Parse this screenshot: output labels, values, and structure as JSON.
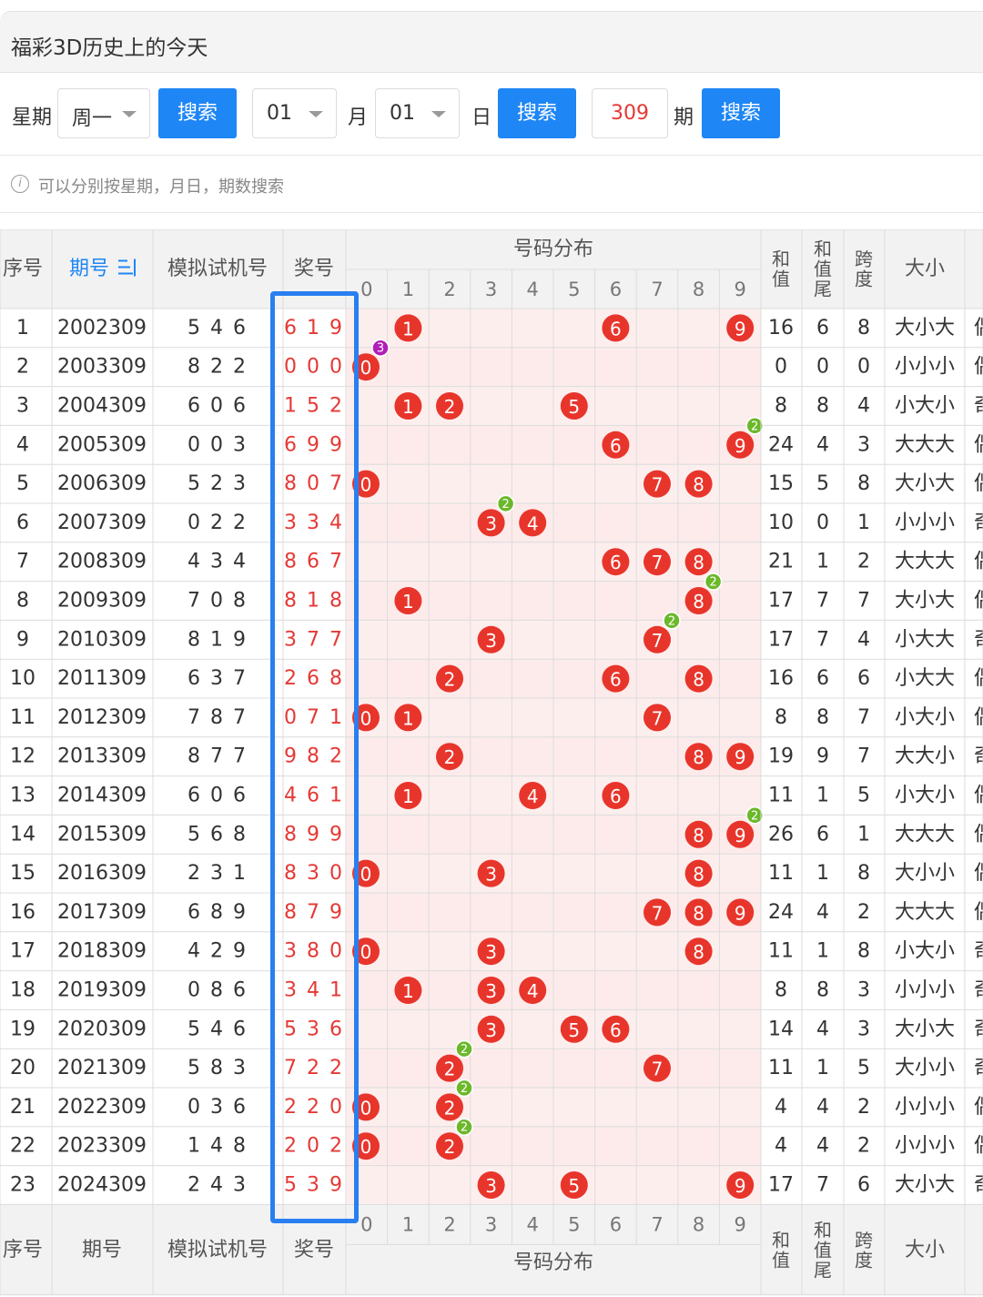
{
  "page_title": "福彩3D历史上的今天",
  "search": {
    "weekday_label": "星期",
    "weekday_value": "周一",
    "search_label": "搜索",
    "month_value": "01",
    "month_label": "月",
    "day_value": "01",
    "day_label": "日",
    "issue_value": "309",
    "issue_label": "期"
  },
  "hint": "可以分别按星期，月日，期数搜索",
  "table": {
    "headers": {
      "index": "序号",
      "issue": "期号",
      "sim": "模拟试机号",
      "prize": "奖号",
      "dist": "号码分布",
      "sum": "和值",
      "sum_tail": "和值尾",
      "span": "跨度",
      "size": "大小"
    },
    "digits": [
      "0",
      "1",
      "2",
      "3",
      "4",
      "5",
      "6",
      "7",
      "8",
      "9"
    ],
    "rows": [
      {
        "idx": "1",
        "issue": "2002309",
        "sim": "5 4 6",
        "prize": "6 1 9",
        "sum": "16",
        "tail": "6",
        "span": "8",
        "size": "大小大",
        "ex": "偶"
      },
      {
        "idx": "2",
        "issue": "2003309",
        "sim": "8 2 2",
        "prize": "0 0 0",
        "sum": "0",
        "tail": "0",
        "span": "0",
        "size": "小小小",
        "ex": "偶"
      },
      {
        "idx": "3",
        "issue": "2004309",
        "sim": "6 0 6",
        "prize": "1 5 2",
        "sum": "8",
        "tail": "8",
        "span": "4",
        "size": "小大小",
        "ex": "奇"
      },
      {
        "idx": "4",
        "issue": "2005309",
        "sim": "0 0 3",
        "prize": "6 9 9",
        "sum": "24",
        "tail": "4",
        "span": "3",
        "size": "大大大",
        "ex": "偶"
      },
      {
        "idx": "5",
        "issue": "2006309",
        "sim": "5 2 3",
        "prize": "8 0 7",
        "sum": "15",
        "tail": "5",
        "span": "8",
        "size": "大小大",
        "ex": "偶"
      },
      {
        "idx": "6",
        "issue": "2007309",
        "sim": "0 2 2",
        "prize": "3 3 4",
        "sum": "10",
        "tail": "0",
        "span": "1",
        "size": "小小小",
        "ex": "奇"
      },
      {
        "idx": "7",
        "issue": "2008309",
        "sim": "4 3 4",
        "prize": "8 6 7",
        "sum": "21",
        "tail": "1",
        "span": "2",
        "size": "大大大",
        "ex": "偶"
      },
      {
        "idx": "8",
        "issue": "2009309",
        "sim": "7 0 8",
        "prize": "8 1 8",
        "sum": "17",
        "tail": "7",
        "span": "7",
        "size": "大小大",
        "ex": "偶"
      },
      {
        "idx": "9",
        "issue": "2010309",
        "sim": "8 1 9",
        "prize": "3 7 7",
        "sum": "17",
        "tail": "7",
        "span": "4",
        "size": "小大大",
        "ex": "奇"
      },
      {
        "idx": "10",
        "issue": "2011309",
        "sim": "6 3 7",
        "prize": "2 6 8",
        "sum": "16",
        "tail": "6",
        "span": "6",
        "size": "小大大",
        "ex": "偶"
      },
      {
        "idx": "11",
        "issue": "2012309",
        "sim": "7 8 7",
        "prize": "0 7 1",
        "sum": "8",
        "tail": "8",
        "span": "7",
        "size": "小大小",
        "ex": "偶"
      },
      {
        "idx": "12",
        "issue": "2013309",
        "sim": "8 7 7",
        "prize": "9 8 2",
        "sum": "19",
        "tail": "9",
        "span": "7",
        "size": "大大小",
        "ex": "奇"
      },
      {
        "idx": "13",
        "issue": "2014309",
        "sim": "6 0 6",
        "prize": "4 6 1",
        "sum": "11",
        "tail": "1",
        "span": "5",
        "size": "小大小",
        "ex": "偶"
      },
      {
        "idx": "14",
        "issue": "2015309",
        "sim": "5 6 8",
        "prize": "8 9 9",
        "sum": "26",
        "tail": "6",
        "span": "1",
        "size": "大大大",
        "ex": "偶"
      },
      {
        "idx": "15",
        "issue": "2016309",
        "sim": "2 3 1",
        "prize": "8 3 0",
        "sum": "11",
        "tail": "1",
        "span": "8",
        "size": "大小小",
        "ex": "偶"
      },
      {
        "idx": "16",
        "issue": "2017309",
        "sim": "6 8 9",
        "prize": "8 7 9",
        "sum": "24",
        "tail": "4",
        "span": "2",
        "size": "大大大",
        "ex": "偶"
      },
      {
        "idx": "17",
        "issue": "2018309",
        "sim": "4 2 9",
        "prize": "3 8 0",
        "sum": "11",
        "tail": "1",
        "span": "8",
        "size": "小大小",
        "ex": "奇"
      },
      {
        "idx": "18",
        "issue": "2019309",
        "sim": "0 8 6",
        "prize": "3 4 1",
        "sum": "8",
        "tail": "8",
        "span": "3",
        "size": "小小小",
        "ex": "奇"
      },
      {
        "idx": "19",
        "issue": "2020309",
        "sim": "5 4 6",
        "prize": "5 3 6",
        "sum": "14",
        "tail": "4",
        "span": "3",
        "size": "大小大",
        "ex": "奇"
      },
      {
        "idx": "20",
        "issue": "2021309",
        "sim": "5 8 3",
        "prize": "7 2 2",
        "sum": "11",
        "tail": "1",
        "span": "5",
        "size": "大小小",
        "ex": "奇"
      },
      {
        "idx": "21",
        "issue": "2022309",
        "sim": "0 3 6",
        "prize": "2 2 0",
        "sum": "4",
        "tail": "4",
        "span": "2",
        "size": "小小小",
        "ex": "偶"
      },
      {
        "idx": "22",
        "issue": "2023309",
        "sim": "1 4 8",
        "prize": "2 0 2",
        "sum": "4",
        "tail": "4",
        "span": "2",
        "size": "小小小",
        "ex": "偶"
      },
      {
        "idx": "23",
        "issue": "2024309",
        "sim": "2 4 3",
        "prize": "5 3 9",
        "sum": "17",
        "tail": "7",
        "span": "6",
        "size": "大小大",
        "ex": "奇"
      }
    ]
  },
  "colors": {
    "accent": "#1e86f5",
    "prize_red": "#e53935",
    "ball_red": "#e8352b",
    "badge_green": "#6bb82a",
    "badge_purple": "#b01fb8",
    "dist_bg": "#fdeeee",
    "highlight_border": "#2a7ff0"
  }
}
